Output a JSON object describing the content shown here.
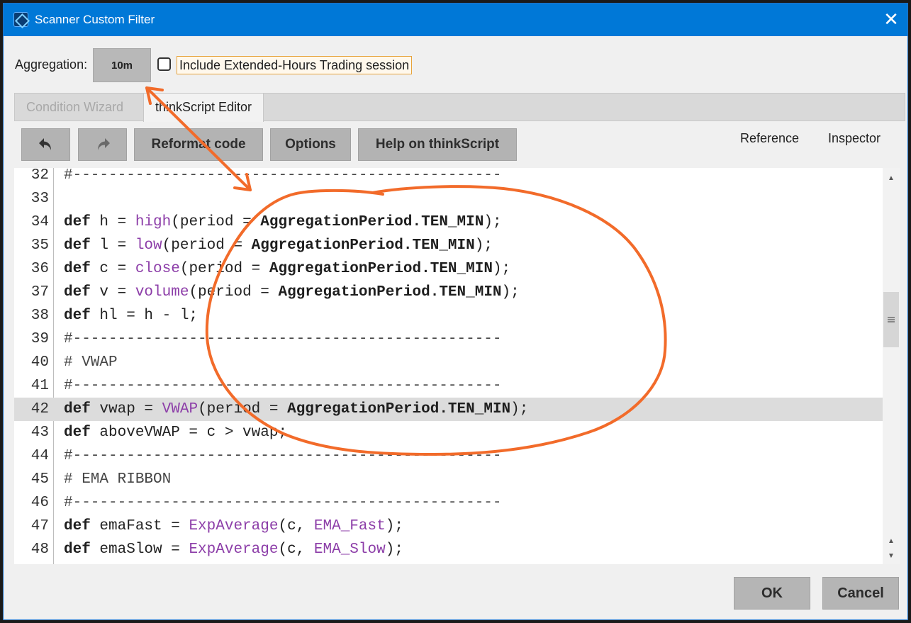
{
  "window": {
    "title": "Scanner Custom Filter",
    "close_glyph": "✕"
  },
  "aggregation": {
    "label": "Aggregation:",
    "value": "10m"
  },
  "extended_hours": {
    "label": "Include Extended-Hours Trading session",
    "checked": false
  },
  "tabs": [
    {
      "label": "Condition Wizard",
      "active": false
    },
    {
      "label": "thinkScript Editor",
      "active": true
    }
  ],
  "toolbar": {
    "undo_icon": "undo-arrow-icon",
    "redo_icon": "redo-arrow-icon",
    "reformat_label": "Reformat code",
    "options_label": "Options",
    "help_label": "Help on thinkScript",
    "reference_label": "Reference",
    "inspector_label": "Inspector"
  },
  "editor": {
    "highlighted_line": "42",
    "lines": [
      {
        "num": "32",
        "tokens": [
          {
            "t": "#------------------------------------------------",
            "c": "cm"
          }
        ]
      },
      {
        "num": "33",
        "tokens": []
      },
      {
        "num": "34",
        "tokens": [
          {
            "t": "def",
            "c": "kw"
          },
          {
            "t": " h = "
          },
          {
            "t": "high",
            "c": "fn"
          },
          {
            "t": "(period = "
          },
          {
            "t": "AggregationPeriod.TEN_MIN",
            "c": "kw"
          },
          {
            "t": ");"
          }
        ]
      },
      {
        "num": "35",
        "tokens": [
          {
            "t": "def",
            "c": "kw"
          },
          {
            "t": " l = "
          },
          {
            "t": "low",
            "c": "fn"
          },
          {
            "t": "(period = "
          },
          {
            "t": "AggregationPeriod.TEN_MIN",
            "c": "kw"
          },
          {
            "t": ");"
          }
        ]
      },
      {
        "num": "36",
        "tokens": [
          {
            "t": "def",
            "c": "kw"
          },
          {
            "t": " c = "
          },
          {
            "t": "close",
            "c": "fn"
          },
          {
            "t": "(period = "
          },
          {
            "t": "AggregationPeriod.TEN_MIN",
            "c": "kw"
          },
          {
            "t": ");"
          }
        ]
      },
      {
        "num": "37",
        "tokens": [
          {
            "t": "def",
            "c": "kw"
          },
          {
            "t": " v = "
          },
          {
            "t": "volume",
            "c": "fn"
          },
          {
            "t": "(period = "
          },
          {
            "t": "AggregationPeriod.TEN_MIN",
            "c": "kw"
          },
          {
            "t": ");"
          }
        ]
      },
      {
        "num": "38",
        "tokens": [
          {
            "t": "def",
            "c": "kw"
          },
          {
            "t": " hl = h - l;"
          }
        ]
      },
      {
        "num": "39",
        "tokens": [
          {
            "t": "#------------------------------------------------",
            "c": "cm"
          }
        ]
      },
      {
        "num": "40",
        "tokens": [
          {
            "t": "# VWAP",
            "c": "cm"
          }
        ]
      },
      {
        "num": "41",
        "tokens": [
          {
            "t": "#------------------------------------------------",
            "c": "cm"
          }
        ]
      },
      {
        "num": "42",
        "tokens": [
          {
            "t": "def",
            "c": "kw"
          },
          {
            "t": " vwap = "
          },
          {
            "t": "VWAP",
            "c": "fn"
          },
          {
            "t": "(period = "
          },
          {
            "t": "AggregationPeriod.TEN_MIN",
            "c": "kw"
          },
          {
            "t": ");"
          }
        ]
      },
      {
        "num": "43",
        "tokens": [
          {
            "t": "def",
            "c": "kw"
          },
          {
            "t": " aboveVWAP = c > vwap;"
          }
        ]
      },
      {
        "num": "44",
        "tokens": [
          {
            "t": "#------------------------------------------------",
            "c": "cm"
          }
        ]
      },
      {
        "num": "45",
        "tokens": [
          {
            "t": "# EMA RIBBON",
            "c": "cm"
          }
        ]
      },
      {
        "num": "46",
        "tokens": [
          {
            "t": "#------------------------------------------------",
            "c": "cm"
          }
        ]
      },
      {
        "num": "47",
        "tokens": [
          {
            "t": "def",
            "c": "kw"
          },
          {
            "t": " emaFast = "
          },
          {
            "t": "ExpAverage",
            "c": "fn"
          },
          {
            "t": "(c, "
          },
          {
            "t": "EMA_Fast",
            "c": "fn"
          },
          {
            "t": ");"
          }
        ]
      },
      {
        "num": "48",
        "tokens": [
          {
            "t": "def",
            "c": "kw"
          },
          {
            "t": " emaSlow = "
          },
          {
            "t": "ExpAverage",
            "c": "fn"
          },
          {
            "t": "(c, "
          },
          {
            "t": "EMA_Slow",
            "c": "fn"
          },
          {
            "t": ");"
          }
        ]
      }
    ]
  },
  "footer": {
    "ok_label": "OK",
    "cancel_label": "Cancel"
  },
  "colors": {
    "titlebar": "#0078d7",
    "keyword": "#1e1e1e",
    "function": "#8c3da8",
    "annotation": "#f26b2a",
    "extended_border": "#e7a33a"
  }
}
